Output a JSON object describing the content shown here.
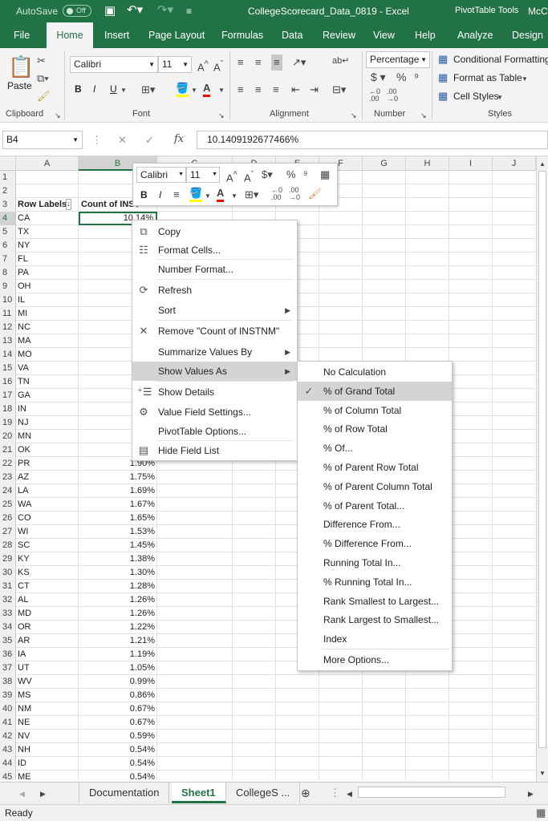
{
  "titlebar": {
    "autosave": "AutoSave",
    "autosave_state": "Off",
    "doc_title": "CollegeScorecard_Data_0819  -  Excel",
    "context_tools": "PivotTable Tools",
    "user": "McC"
  },
  "tabs": [
    "File",
    "Home",
    "Insert",
    "Page Layout",
    "Formulas",
    "Data",
    "Review",
    "View",
    "Help",
    "Analyze",
    "Design"
  ],
  "ribbon": {
    "clipboard": {
      "label": "Clipboard",
      "paste": "Paste"
    },
    "font": {
      "label": "Font",
      "name": "Calibri",
      "size": "11",
      "bold": "B",
      "italic": "I",
      "underline": "U"
    },
    "alignment": {
      "label": "Alignment"
    },
    "number": {
      "label": "Number",
      "format": "Percentage"
    },
    "styles": {
      "label": "Styles",
      "conditional": "Conditional Formatting",
      "table": "Format as Table",
      "cell": "Cell Styles"
    }
  },
  "formula_bar": {
    "name_box": "B4",
    "formula": "10.1409192677466%",
    "fx": "fx"
  },
  "columns": [
    "A",
    "B",
    "C",
    "D",
    "E",
    "F",
    "G",
    "H",
    "I",
    "J"
  ],
  "pivot": {
    "header_a": "Row Labels",
    "header_b": "Count of INSTNM",
    "filter_icon": "filter-dropdown-icon"
  },
  "rows": [
    {
      "n": "1",
      "a": "",
      "b": ""
    },
    {
      "n": "2",
      "a": "",
      "b": ""
    },
    {
      "n": "3",
      "a": "Row Labels",
      "b": "Count of INST"
    },
    {
      "n": "4",
      "a": "CA",
      "b": "10.14%"
    },
    {
      "n": "5",
      "a": "TX",
      "b": ""
    },
    {
      "n": "6",
      "a": "NY",
      "b": ""
    },
    {
      "n": "7",
      "a": "FL",
      "b": ""
    },
    {
      "n": "8",
      "a": "PA",
      "b": ""
    },
    {
      "n": "9",
      "a": "OH",
      "b": ""
    },
    {
      "n": "10",
      "a": "IL",
      "b": ""
    },
    {
      "n": "11",
      "a": "MI",
      "b": ""
    },
    {
      "n": "12",
      "a": "NC",
      "b": ""
    },
    {
      "n": "13",
      "a": "MA",
      "b": ""
    },
    {
      "n": "14",
      "a": "MO",
      "b": ""
    },
    {
      "n": "15",
      "a": "VA",
      "b": ""
    },
    {
      "n": "16",
      "a": "TN",
      "b": ""
    },
    {
      "n": "17",
      "a": "GA",
      "b": ""
    },
    {
      "n": "18",
      "a": "IN",
      "b": ""
    },
    {
      "n": "19",
      "a": "NJ",
      "b": ""
    },
    {
      "n": "20",
      "a": "MN",
      "b": ""
    },
    {
      "n": "21",
      "a": "OK",
      "b": ""
    },
    {
      "n": "22",
      "a": "PR",
      "b": "1.90%"
    },
    {
      "n": "23",
      "a": "AZ",
      "b": "1.75%"
    },
    {
      "n": "24",
      "a": "LA",
      "b": "1.69%"
    },
    {
      "n": "25",
      "a": "WA",
      "b": "1.67%"
    },
    {
      "n": "26",
      "a": "CO",
      "b": "1.65%"
    },
    {
      "n": "27",
      "a": "WI",
      "b": "1.53%"
    },
    {
      "n": "28",
      "a": "SC",
      "b": "1.45%"
    },
    {
      "n": "29",
      "a": "KY",
      "b": "1.38%"
    },
    {
      "n": "30",
      "a": "KS",
      "b": "1.30%"
    },
    {
      "n": "31",
      "a": "CT",
      "b": "1.28%"
    },
    {
      "n": "32",
      "a": "AL",
      "b": "1.26%"
    },
    {
      "n": "33",
      "a": "MD",
      "b": "1.26%"
    },
    {
      "n": "34",
      "a": "OR",
      "b": "1.22%"
    },
    {
      "n": "35",
      "a": "AR",
      "b": "1.21%"
    },
    {
      "n": "36",
      "a": "IA",
      "b": "1.19%"
    },
    {
      "n": "37",
      "a": "UT",
      "b": "1.05%"
    },
    {
      "n": "38",
      "a": "WV",
      "b": "0.99%"
    },
    {
      "n": "39",
      "a": "MS",
      "b": "0.86%"
    },
    {
      "n": "40",
      "a": "NM",
      "b": "0.67%"
    },
    {
      "n": "41",
      "a": "NE",
      "b": "0.67%"
    },
    {
      "n": "42",
      "a": "NV",
      "b": "0.59%"
    },
    {
      "n": "43",
      "a": "NH",
      "b": "0.54%"
    },
    {
      "n": "44",
      "a": "ID",
      "b": "0.54%"
    },
    {
      "n": "45",
      "a": "ME",
      "b": "0.54%"
    }
  ],
  "mini_toolbar": {
    "font": "Calibri",
    "size": "11",
    "bold": "B",
    "italic": "I"
  },
  "context_menu": [
    {
      "label": "Copy",
      "icon": "copy-icon"
    },
    {
      "label": "Format Cells...",
      "icon": "format-cells-icon"
    },
    {
      "label": "Number Format...",
      "icon": ""
    },
    {
      "label": "Refresh",
      "icon": "refresh-icon"
    },
    {
      "label": "Sort",
      "icon": "",
      "submenu": true
    },
    {
      "label": "Remove \"Count of INSTNM\"",
      "icon": "remove-x-icon"
    },
    {
      "label": "Summarize Values By",
      "icon": "",
      "submenu": true
    },
    {
      "label": "Show Values As",
      "icon": "",
      "submenu": true,
      "highlighted": true
    },
    {
      "label": "Show Details",
      "icon": "show-details-icon"
    },
    {
      "label": "Value Field Settings...",
      "icon": "field-settings-icon"
    },
    {
      "label": "PivotTable Options...",
      "icon": ""
    },
    {
      "label": "Hide Field List",
      "icon": "field-list-icon"
    }
  ],
  "submenu": [
    {
      "label": "No Calculation"
    },
    {
      "label": "% of Grand Total",
      "checked": true
    },
    {
      "label": "% of Column Total"
    },
    {
      "label": "% of Row Total"
    },
    {
      "label": "% Of..."
    },
    {
      "label": "% of Parent Row Total"
    },
    {
      "label": "% of Parent Column Total"
    },
    {
      "label": "% of Parent Total..."
    },
    {
      "label": "Difference From..."
    },
    {
      "label": "% Difference From..."
    },
    {
      "label": "Running Total In..."
    },
    {
      "label": "% Running Total In..."
    },
    {
      "label": "Rank Smallest to Largest..."
    },
    {
      "label": "Rank Largest to Smallest..."
    },
    {
      "label": "Index"
    },
    {
      "label": "More Options..."
    }
  ],
  "sheets": [
    "Documentation",
    "Sheet1",
    "CollegeS ..."
  ],
  "active_sheet": "Sheet1",
  "status": "Ready",
  "colors": {
    "excel_green": "#217346",
    "highlight": "#d4d4d4"
  }
}
